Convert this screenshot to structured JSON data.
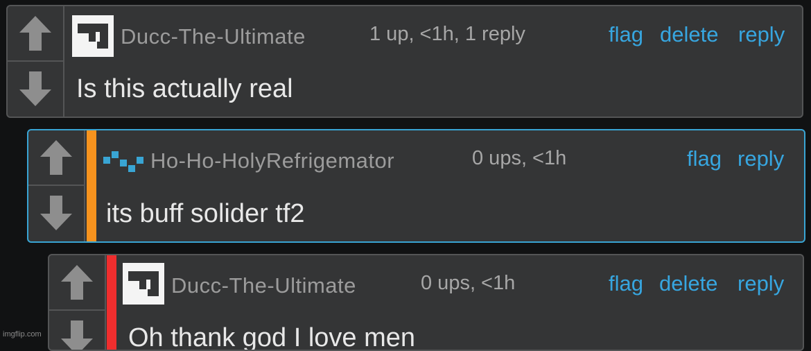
{
  "comments": [
    {
      "username": "Ducc-The-Ultimate",
      "meta": "1 up, <1h, 1 reply",
      "actions": [
        "flag",
        "delete",
        "reply"
      ],
      "text": "Is this actually real",
      "avatar_icon": "block-logo-icon",
      "stripe_color": null
    },
    {
      "username": "Ho-Ho-HolyRefrigemator",
      "meta": "0 ups, <1h",
      "actions": [
        "flag",
        "reply"
      ],
      "text": "its buff solider tf2",
      "avatar_icon": "pixel-pattern-icon",
      "stripe_color": "#f7931e",
      "highlight_color": "#39a5d4"
    },
    {
      "username": "Ducc-The-Ultimate",
      "meta": "0 ups, <1h",
      "actions": [
        "flag",
        "delete",
        "reply"
      ],
      "text": "Oh thank god I love men",
      "avatar_icon": "block-logo-icon",
      "stripe_color": "#f02e2e"
    }
  ],
  "watermark": "imgflip.com"
}
